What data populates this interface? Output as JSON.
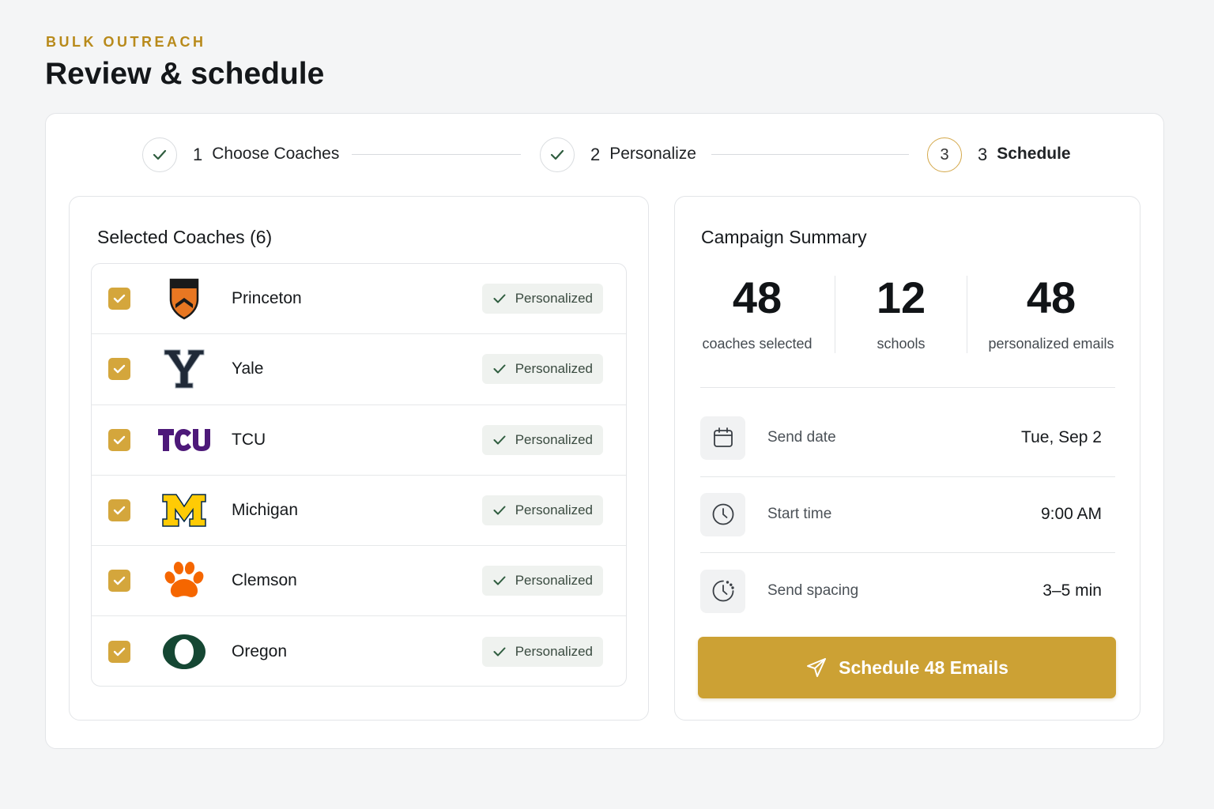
{
  "header": {
    "eyebrow": "BULK OUTREACH",
    "title": "Review & schedule"
  },
  "stepper": {
    "steps": [
      {
        "num": "1",
        "label": "Choose Coaches",
        "state": "complete"
      },
      {
        "num": "2",
        "label": "Personalize",
        "state": "complete"
      },
      {
        "num": "3",
        "label": "Schedule",
        "state": "active",
        "circle": "3"
      }
    ]
  },
  "coaches": {
    "title": "Selected Coaches (6)",
    "rows": [
      {
        "school": "Princeton",
        "status": "Personalized",
        "logo": "princeton-shield-logo"
      },
      {
        "school": "Yale",
        "status": "Personalized",
        "logo": "yale-y-logo"
      },
      {
        "school": "TCU",
        "status": "Personalized",
        "logo": "tcu-logo"
      },
      {
        "school": "Michigan",
        "status": "Personalized",
        "logo": "michigan-block-m-logo"
      },
      {
        "school": "Clemson",
        "status": "Personalized",
        "logo": "clemson-paw-logo"
      },
      {
        "school": "Oregon",
        "status": "Personalized",
        "logo": "oregon-o-logo"
      }
    ]
  },
  "summary": {
    "title": "Campaign Summary",
    "stats": [
      {
        "value": "48",
        "label": "coaches selected"
      },
      {
        "value": "12",
        "label": "schools"
      },
      {
        "value": "48",
        "label": "personalized emails"
      }
    ],
    "details": [
      {
        "label": "Send date",
        "value": "Tue, Sep 2",
        "icon": "calendar-icon"
      },
      {
        "label": "Start time",
        "value": "9:00 AM",
        "icon": "clock-icon"
      },
      {
        "label": "Send spacing",
        "value": "3–5 min",
        "icon": "clock-spacing-icon"
      }
    ],
    "cta_label": "Schedule 48 Emails"
  },
  "colors": {
    "accent": "#cca134",
    "eyebrow": "#b88a1b",
    "checkbox": "#d4a63c",
    "badge_bg": "#eff2ef",
    "check_green": "#2f5d3f"
  }
}
